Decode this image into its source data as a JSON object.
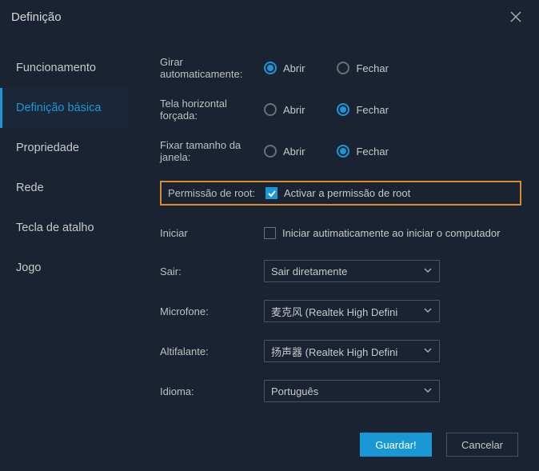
{
  "title": "Definição",
  "sidebar": {
    "items": [
      {
        "label": "Funcionamento"
      },
      {
        "label": "Definição básica"
      },
      {
        "label": "Propriedade"
      },
      {
        "label": "Rede"
      },
      {
        "label": "Tecla de atalho"
      },
      {
        "label": "Jogo"
      }
    ],
    "active_index": 1
  },
  "labels": {
    "rotate": "Girar automaticamente:",
    "horizontal": "Tela horizontal forçada:",
    "fixsize": "Fixar tamanho da janela:",
    "root": "Permissão de root:",
    "start": "Iniciar",
    "exit": "Sair:",
    "mic": "Microfone:",
    "speaker": "Altifalante:",
    "lang": "Idioma:"
  },
  "options": {
    "open": "Abrir",
    "close": "Fechar"
  },
  "values": {
    "rotate": "open",
    "horizontal": "close",
    "fixsize": "close",
    "root_checked": true,
    "root_label": "Activar a permissão de root",
    "autostart_checked": false,
    "autostart_label": "Iniciar autimaticamente ao iniciar o computador",
    "exit_select": "Sair diretamente",
    "mic_select": "麦克风 (Realtek High Defini",
    "speaker_select": "扬声器 (Realtek High Defini",
    "lang_select": "Português"
  },
  "buttons": {
    "save": "Guardar!",
    "cancel": "Cancelar"
  },
  "colors": {
    "accent": "#1a98d6",
    "highlight_border": "#d98a2b",
    "bg": "#1a2332"
  }
}
